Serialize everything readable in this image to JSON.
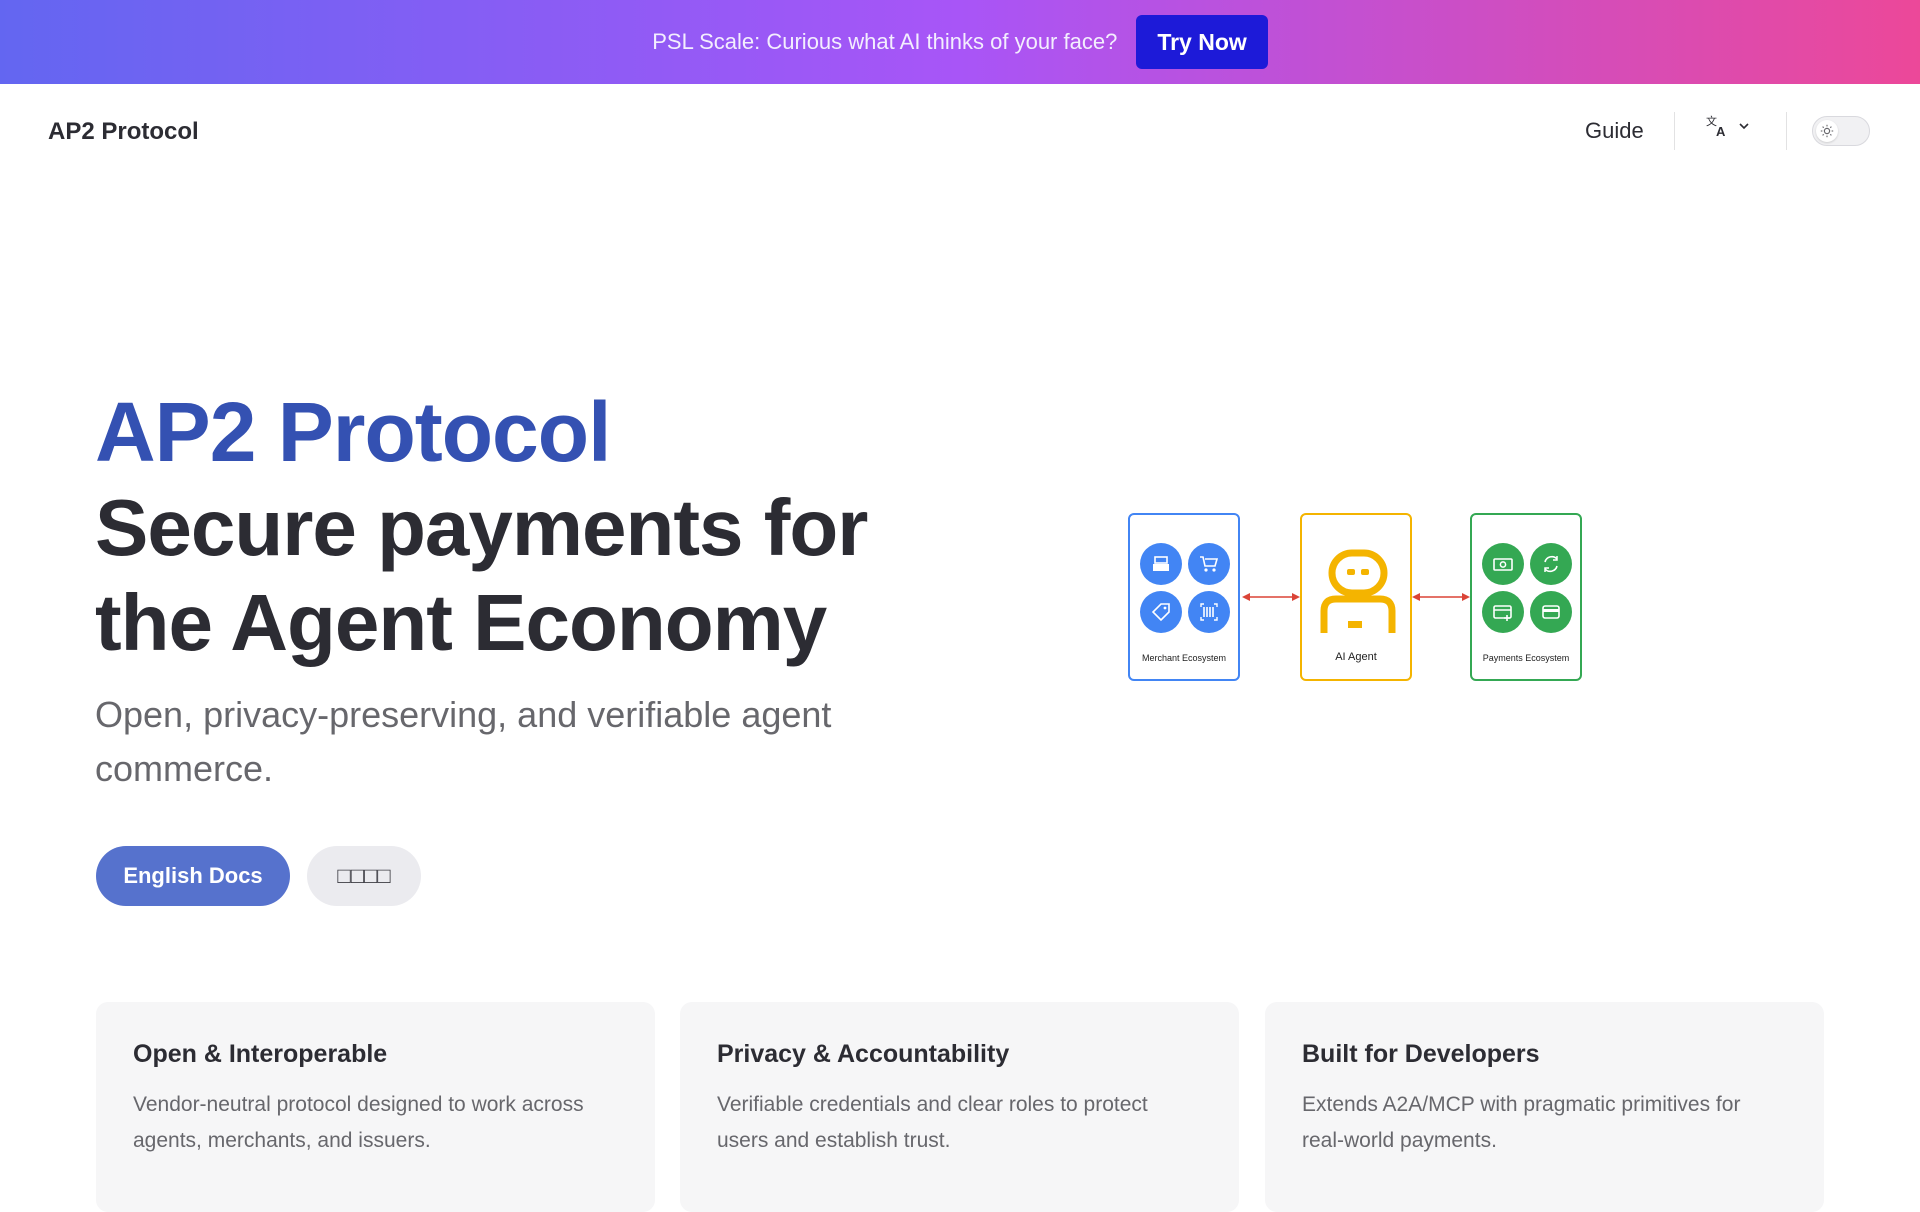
{
  "banner": {
    "text": "PSL Scale: Curious what AI thinks of your face?",
    "button": "Try Now"
  },
  "nav": {
    "brand": "AP2 Protocol",
    "guide": "Guide",
    "language_icon": "translate-icon",
    "theme_icon": "sun-icon"
  },
  "hero": {
    "name": "AP2 Protocol",
    "text": "Secure payments for the Agent Economy",
    "tagline": "Open, privacy-preserving, and verifiable agent commerce.",
    "actions": [
      {
        "label": "English Docs",
        "style": "primary"
      },
      {
        "label": "□□□□",
        "style": "alt"
      }
    ]
  },
  "diagram": {
    "boxes": [
      {
        "label": "Merchant Ecosystem",
        "color": "#4285f4",
        "icons": [
          "cash-register-icon",
          "cart-icon",
          "tag-icon",
          "barcode-icon"
        ]
      },
      {
        "label": "AI Agent",
        "color": "#f4b400",
        "icons": [
          "robot-icon"
        ]
      },
      {
        "label": "Payments Ecosystem",
        "color": "#34a853",
        "icons": [
          "money-icon",
          "exchange-icon",
          "card-add-icon",
          "wallet-icon"
        ]
      }
    ],
    "arrow_color": "#db4437"
  },
  "features": [
    {
      "title": "Open & Interoperable",
      "details": "Vendor-neutral protocol designed to work across agents, merchants, and issuers."
    },
    {
      "title": "Privacy & Accountability",
      "details": "Verifiable credentials and clear roles to protect users and establish trust."
    },
    {
      "title": "Built for Developers",
      "details": "Extends A2A/MCP with pragmatic primitives for real-world payments."
    }
  ],
  "colors": {
    "brand": "#3451b2",
    "primary_button": "#5672cd",
    "banner_button": "#1d1ad8"
  }
}
